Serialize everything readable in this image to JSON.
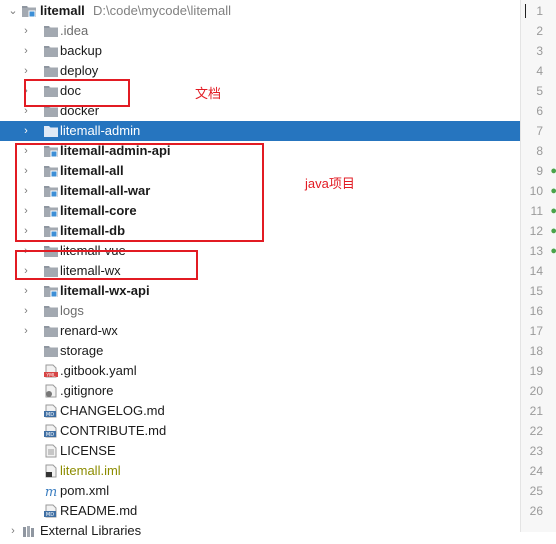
{
  "project": {
    "name": "litemall",
    "path": "D:\\code\\mycode\\litemall"
  },
  "tree": [
    {
      "label": "litemall",
      "depth": 0,
      "expanded": true,
      "icon": "module-folder-icon"
    },
    {
      "label": ".idea",
      "dim": true,
      "icon": "folder-icon"
    },
    {
      "label": "backup",
      "icon": "folder-icon"
    },
    {
      "label": "deploy",
      "icon": "folder-icon"
    },
    {
      "label": "doc",
      "icon": "folder-icon"
    },
    {
      "label": "docker",
      "icon": "folder-icon"
    },
    {
      "label": "litemall-admin",
      "selected": true,
      "icon": "folder-icon"
    },
    {
      "label": "litemall-admin-api",
      "bold": true,
      "icon": "module-folder-icon"
    },
    {
      "label": "litemall-all",
      "bold": true,
      "icon": "module-folder-icon"
    },
    {
      "label": "litemall-all-war",
      "bold": true,
      "icon": "module-folder-icon"
    },
    {
      "label": "litemall-core",
      "bold": true,
      "icon": "module-folder-icon"
    },
    {
      "label": "litemall-db",
      "bold": true,
      "icon": "module-folder-icon"
    },
    {
      "label": "litemall-vue",
      "icon": "folder-icon"
    },
    {
      "label": "litemall-wx",
      "icon": "folder-icon"
    },
    {
      "label": "litemall-wx-api",
      "bold": true,
      "icon": "module-folder-icon"
    },
    {
      "label": "logs",
      "dim": true,
      "icon": "folder-icon"
    },
    {
      "label": "renard-wx",
      "icon": "folder-icon"
    },
    {
      "label": "storage",
      "noarrow": true,
      "icon": "folder-icon"
    },
    {
      "label": ".gitbook.yaml",
      "file": true,
      "icon": "yaml-file-icon"
    },
    {
      "label": ".gitignore",
      "file": true,
      "icon": "gitignore-file-icon"
    },
    {
      "label": "CHANGELOG.md",
      "file": true,
      "icon": "markdown-file-icon"
    },
    {
      "label": "CONTRIBUTE.md",
      "file": true,
      "icon": "markdown-file-icon"
    },
    {
      "label": "LICENSE",
      "file": true,
      "icon": "text-file-icon"
    },
    {
      "label": "litemall.iml",
      "file": true,
      "olive": true,
      "icon": "iml-file-icon"
    },
    {
      "label": "pom.xml",
      "file": true,
      "icon": "maven-file-icon"
    },
    {
      "label": "README.md",
      "file": true,
      "icon": "markdown-file-icon"
    },
    {
      "label": "External Libraries",
      "depth": 0,
      "icon": "library-icon"
    }
  ],
  "gutter": {
    "lines": [
      "1",
      "2",
      "3",
      "4",
      "5",
      "6",
      "7",
      "8",
      "9",
      "10",
      "11",
      "12",
      "13",
      "14",
      "15",
      "16",
      "17",
      "18",
      "19",
      "20",
      "21",
      "22",
      "23",
      "24",
      "25",
      "26"
    ]
  },
  "annotations": {
    "doc_label": "文档",
    "java_label": "java项目"
  },
  "colors": {
    "selection": "#2675bf",
    "annotation": "#e21b23"
  }
}
